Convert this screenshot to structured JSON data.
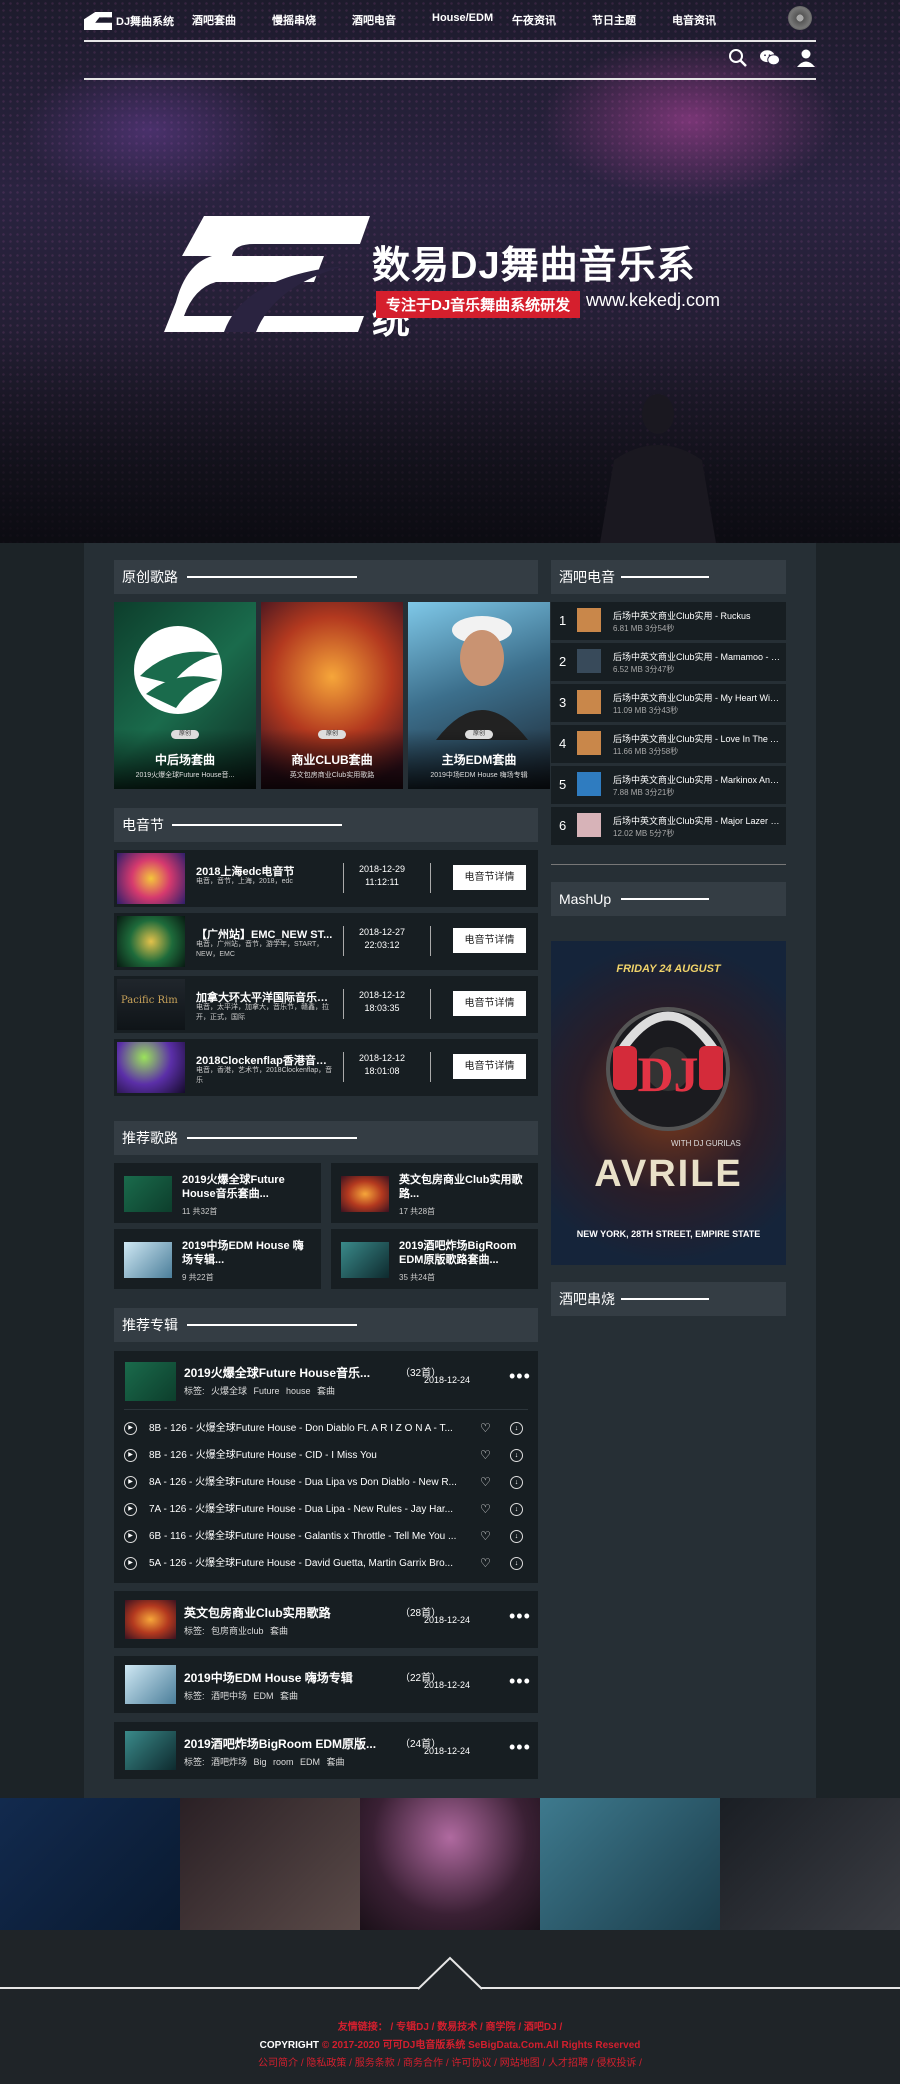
{
  "header": {
    "site_name": "DJ舞曲系统",
    "nav": [
      "酒吧套曲",
      "慢摇串烧",
      "酒吧电音",
      "House/EDM",
      "午夜资讯",
      "节日主题",
      "电音资讯"
    ]
  },
  "hero": {
    "title": "数易DJ舞曲音乐系统",
    "tagline": "专注于DJ音乐舞曲系统研发",
    "url": "www.kekedj.com"
  },
  "original": {
    "heading": "原创歌路",
    "cards": [
      {
        "badge": "原创",
        "name": "中后场套曲",
        "desc": "2019火爆全球Future House音..."
      },
      {
        "badge": "原创",
        "name": "商业CLUB套曲",
        "desc": "英文包房商业Club实用歌路"
      },
      {
        "badge": "原创",
        "name": "主场EDM套曲",
        "desc": "2019中场EDM House 嗨场专辑"
      }
    ]
  },
  "festival": {
    "heading": "电音节",
    "items": [
      {
        "title": "2018上海edc电音节",
        "tags": "电音，音节，上海，2018，edc",
        "date": "2018-12-29",
        "time": "11:12:11",
        "button": "电音节详情"
      },
      {
        "title": "【广州站】EMC_NEW ST...",
        "tags": "电音，广州站，音节，游学年，START，NEW，EMC",
        "date": "2018-12-27",
        "time": "22:03:12",
        "button": "电音节详情"
      },
      {
        "title": "加拿大环太平洋国际音乐节...",
        "tags": "电音，太平洋，加拿大，音乐节，赣鑫，拉开，正式，国际",
        "date": "2018-12-12",
        "time": "18:03:35",
        "button": "电音节详情"
      },
      {
        "title": "2018Clockenflap香港音乐...",
        "tags": "电音，香港，艺术节，2018Clockenflap，音乐",
        "date": "2018-12-12",
        "time": "18:01:08",
        "button": "电音节详情"
      }
    ]
  },
  "recommend_songs": {
    "heading": "推荐歌路",
    "items": [
      {
        "title": "2019火爆全球Future House音乐套曲...",
        "meta": "11  共32首"
      },
      {
        "title": "英文包房商业Club实用歌路...",
        "meta": "17  共28首"
      },
      {
        "title": "2019中场EDM House 嗨场专辑...",
        "meta": "9  共22首"
      },
      {
        "title": "2019酒吧炸场BigRoom EDM原版歌路套曲...",
        "meta": "35  共24首"
      }
    ]
  },
  "recommend_albums": {
    "heading": "推荐专辑",
    "albums": [
      {
        "name": "2019火爆全球Future House音乐...",
        "count": "（32首）",
        "tags": "标签: 火爆全球  Future house  套曲",
        "date": "2018-12-24",
        "more": "•••",
        "tracks": [
          "8B - 126 - 火爆全球Future House - Don Diablo Ft. A R I Z O N A - T...",
          "8B - 126 - 火爆全球Future House - CID - I Miss You",
          "8A - 126 - 火爆全球Future House - Dua Lipa vs Don Diablo - New R...",
          "7A - 126 - 火爆全球Future House - Dua Lipa - New Rules - Jay Har...",
          "6B - 116 - 火爆全球Future House - Galantis x Throttle - Tell Me You ...",
          "5A - 126 - 火爆全球Future House - David Guetta, Martin Garrix Bro..."
        ]
      },
      {
        "name": "英文包房商业Club实用歌路",
        "count": "（28首）",
        "tags": "标签: 包房商业club  套曲",
        "date": "2018-12-24",
        "more": "•••",
        "tracks": []
      },
      {
        "name": "2019中场EDM House 嗨场专辑",
        "count": "（22首）",
        "tags": "标签: 酒吧中场  EDM  套曲",
        "date": "2018-12-24",
        "more": "•••",
        "tracks": []
      },
      {
        "name": "2019酒吧炸场BigRoom EDM原版...",
        "count": "（24首）",
        "tags": "标签: 酒吧炸场  Big room  EDM  套曲",
        "date": "2018-12-24",
        "more": "•••",
        "tracks": []
      }
    ]
  },
  "bar_electro": {
    "heading": "酒吧电音",
    "items": [
      {
        "rank": "1",
        "title": "后场中英文商业Club实用 - Ruckus",
        "meta": "6.81 MB    3分54秒"
      },
      {
        "rank": "2",
        "title": "后场中英文商业Club实用 - Mamamoo - P...",
        "meta": "6.52 MB    3分47秒"
      },
      {
        "rank": "3",
        "title": "后场中英文商业Club实用 - My Heart Will ...",
        "meta": "11.09 MB    3分43秒"
      },
      {
        "rank": "4",
        "title": "后场中英文商业Club实用 - Love In The Ai...",
        "meta": "11.66 MB    3分58秒"
      },
      {
        "rank": "5",
        "title": "后场中英文商业Club实用 - Markinox And ...",
        "meta": "7.88 MB    3分21秒"
      },
      {
        "rank": "6",
        "title": "后场中英文商业Club实用 - Major Lazer P...",
        "meta": "12.02 MB    5分7秒"
      }
    ]
  },
  "mashup": {
    "heading": "MashUp",
    "poster": {
      "top": "FRIDAY 24 AUGUST",
      "with": "WITH DJ GURILAS",
      "name": "AVRILE",
      "address": "NEW YORK, 28TH STREET, EMPIRE STATE"
    }
  },
  "medley": {
    "heading": "酒吧串烧"
  },
  "footer": {
    "links": "友情链接：  /  专辑DJ  /  数易技术  /  商学院  /  酒吧DJ  /",
    "copyright_label": "COPYRIGHT",
    "copyright": "© 2017-2020 可可DJ电音版系统 SeBigData.Com.All Rights Reserved",
    "bottom_links": "公司简介 / 隐私政策 / 服务条款 / 商务合作 / 许可协议 / 网站地图 / 人才招聘 / 侵权投诉 /"
  },
  "colors": {
    "accent": "#d51f2d",
    "panel": "#262f35",
    "row": "#171e22",
    "head": "#343d44"
  }
}
